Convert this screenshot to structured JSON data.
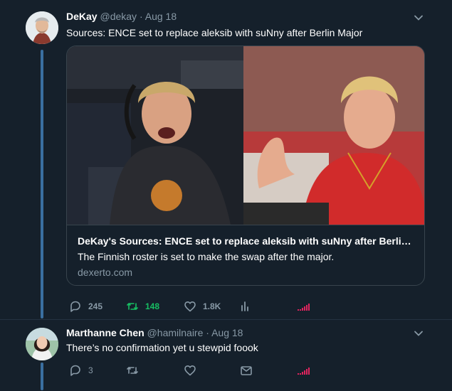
{
  "tweets": [
    {
      "name": "DeKay",
      "handle": "@dekay",
      "separator": "·",
      "date": "Aug 18",
      "text": "Sources: ENCE set to replace aleksib with suNny after Berlin Major",
      "card": {
        "title": "DeKay's Sources: ENCE set to replace aleksib with suNny after Berlin Major",
        "description": "The Finnish roster is set to make the swap after the major.",
        "domain": "dexerto.com"
      },
      "actions": {
        "replies": "245",
        "retweets": "148",
        "likes": "1.8K"
      },
      "icons": [
        "reply-icon",
        "retweet-icon",
        "like-icon",
        "analytics-icon",
        "promote-icon"
      ]
    },
    {
      "name": "Marthanne Chen",
      "handle": "@hamilnaire",
      "separator": "·",
      "date": "Aug 18",
      "text": "There’s no confirmation yet u stewpid foook",
      "actions": {
        "replies": "3"
      },
      "icons": [
        "reply-icon",
        "retweet-icon",
        "like-icon",
        "message-icon",
        "promote-icon"
      ]
    }
  ],
  "colors": {
    "background": "#15202b",
    "text_secondary": "#8899a6",
    "retweet_active": "#17bf63",
    "thread_line": "#3a6fa0",
    "promote_icon": "#e0245e"
  }
}
